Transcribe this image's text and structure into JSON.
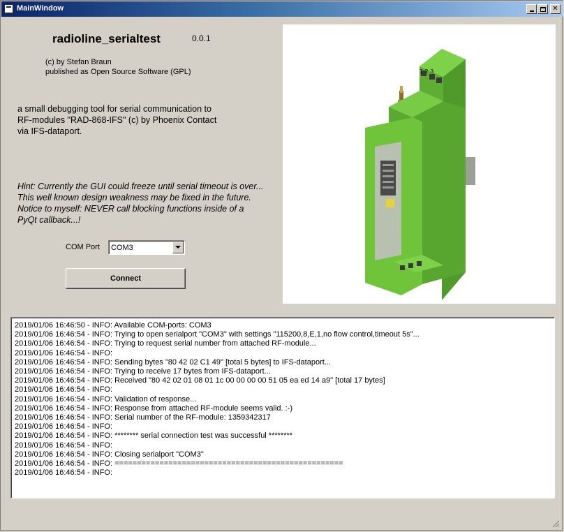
{
  "window": {
    "title": "MainWindow"
  },
  "app": {
    "name": "radioline_serialtest",
    "version": "0.0.1",
    "credits": [
      "(c) by Stefan Braun",
      "published as Open Source Software (GPL)"
    ],
    "description": [
      "a small debugging tool for serial communication to",
      "RF-modules \"RAD-868-IFS\" (c) by Phoenix Contact",
      "via IFS-dataport."
    ],
    "hint": [
      "Hint: Currently the GUI could freeze until serial timeout is over...",
      "This well known design weakness may be fixed in the future.",
      "Notice to myself: NEVER call blocking functions inside of a",
      "PyQt callback...!"
    ]
  },
  "connection": {
    "com_port_label": "COM Port",
    "com_port_value": "COM3",
    "connect_label": "Connect"
  },
  "device_label": "1 2 3",
  "colors": {
    "titlebar_start": "#0a246a",
    "window_bg": "#d4d0c8",
    "device_green": "#6fc43a"
  },
  "log": [
    "2019/01/06 16:46:50 - INFO: Available COM-ports: COM3",
    "2019/01/06 16:46:54 - INFO: Trying to open serialport \"COM3\" with settings \"115200,8,E,1,no flow control,timeout 5s\"...",
    "2019/01/06 16:46:54 - INFO: Trying to request serial number from attached RF-module...",
    "2019/01/06 16:46:54 - INFO:",
    "2019/01/06 16:46:54 - INFO: Sending bytes \"80 42 02 C1 49\" [total 5 bytes] to IFS-dataport...",
    "2019/01/06 16:46:54 - INFO: Trying to receive 17 bytes from IFS-dataport...",
    "2019/01/06 16:46:54 - INFO: Received \"80 42 02 01 08 01 1c 00 00 00 00 51 05 ea ed 14 a9\" [total 17 bytes]",
    "2019/01/06 16:46:54 - INFO:",
    "2019/01/06 16:46:54 - INFO: Validation of response...",
    "2019/01/06 16:46:54 - INFO: Response from attached RF-module seems valid. :-)",
    "2019/01/06 16:46:54 - INFO: Serial number of the RF-module: 1359342317",
    "2019/01/06 16:46:54 - INFO:",
    "2019/01/06 16:46:54 - INFO: ******** serial connection test was successful ********",
    "2019/01/06 16:46:54 - INFO:",
    "2019/01/06 16:46:54 - INFO: Closing serialport \"COM3\"",
    "2019/01/06 16:46:54 - INFO: ===================================================",
    "2019/01/06 16:46:54 - INFO:"
  ]
}
